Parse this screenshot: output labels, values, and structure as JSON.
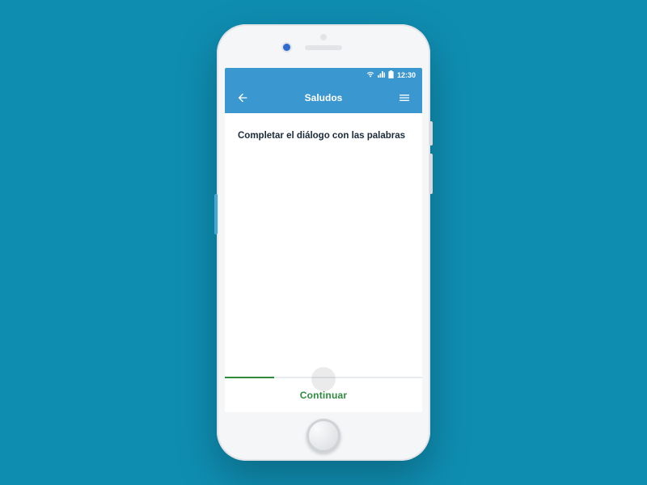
{
  "status": {
    "time": "12:30"
  },
  "appbar": {
    "title": "Saludos"
  },
  "content": {
    "instruction": "Completar el diálogo con las palabras"
  },
  "footer": {
    "continue_label": "Continuar"
  },
  "progress": {
    "percent": 25
  },
  "colors": {
    "primary": "#3b97cf",
    "accent": "#2e8b3d",
    "bg": "#0f8db1"
  }
}
